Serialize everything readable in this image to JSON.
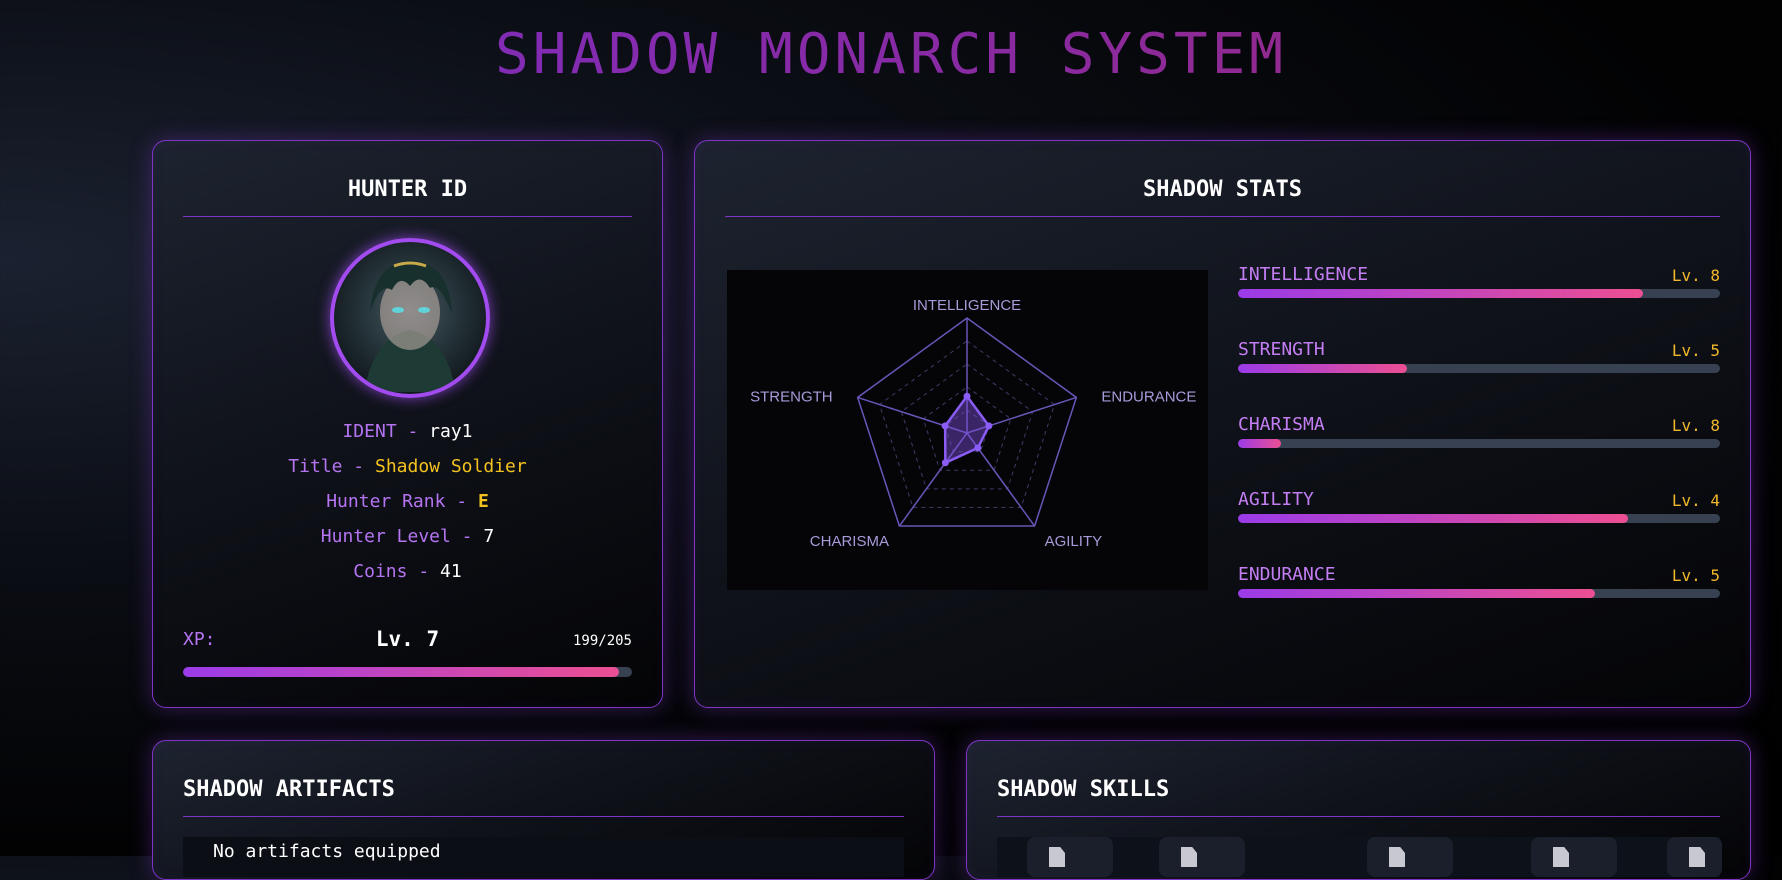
{
  "app_title": "SHADOW MONARCH SYSTEM",
  "hunter_id": {
    "heading": "HUNTER ID",
    "ident_label": "IDENT - ",
    "ident_value": "ray1",
    "title_label": "Title - ",
    "title_value": "Shadow Soldier",
    "rank_label": "Hunter Rank - ",
    "rank_value": "E",
    "level_label": "Hunter Level - ",
    "level_value": "7",
    "coins_label": "Coins - ",
    "coins_value": "41",
    "xp_label": "XP:",
    "xp_level": "Lv. 7",
    "xp_count": "199/205",
    "xp_fraction": 0.97
  },
  "shadow_stats": {
    "heading": "SHADOW STATS",
    "stats": [
      {
        "name": "INTELLIGENCE",
        "level": "Lv. 8",
        "progress": 0.84
      },
      {
        "name": "STRENGTH",
        "level": "Lv. 5",
        "progress": 0.35
      },
      {
        "name": "CHARISMA",
        "level": "Lv. 8",
        "progress": 0.09
      },
      {
        "name": "AGILITY",
        "level": "Lv. 4",
        "progress": 0.81
      },
      {
        "name": "ENDURANCE",
        "level": "Lv. 5",
        "progress": 0.74
      }
    ]
  },
  "chart_data": {
    "type": "radar",
    "axes": [
      "INTELLIGENCE",
      "ENDURANCE",
      "AGILITY",
      "CHARISMA",
      "STRENGTH"
    ],
    "values": [
      8,
      5,
      4,
      8,
      5
    ],
    "max": 25,
    "grid_rings": 5,
    "colors": {
      "fill": "#7c4ddc",
      "stroke": "#8b5cf6",
      "grid": "#3f3a66"
    }
  },
  "artifacts": {
    "heading": "SHADOW ARTIFACTS",
    "empty_text": "No artifacts equipped"
  },
  "skills": {
    "heading": "SHADOW SKILLS",
    "skill_icons": [
      "file-icon",
      "file-icon",
      "file-icon",
      "file-icon",
      "file-icon"
    ]
  },
  "colors": {
    "accent": "#7e35c6",
    "label": "#b574f2",
    "gold": "#f4c21f",
    "bar_start": "#9b3be8",
    "bar_end": "#ec4f92"
  }
}
